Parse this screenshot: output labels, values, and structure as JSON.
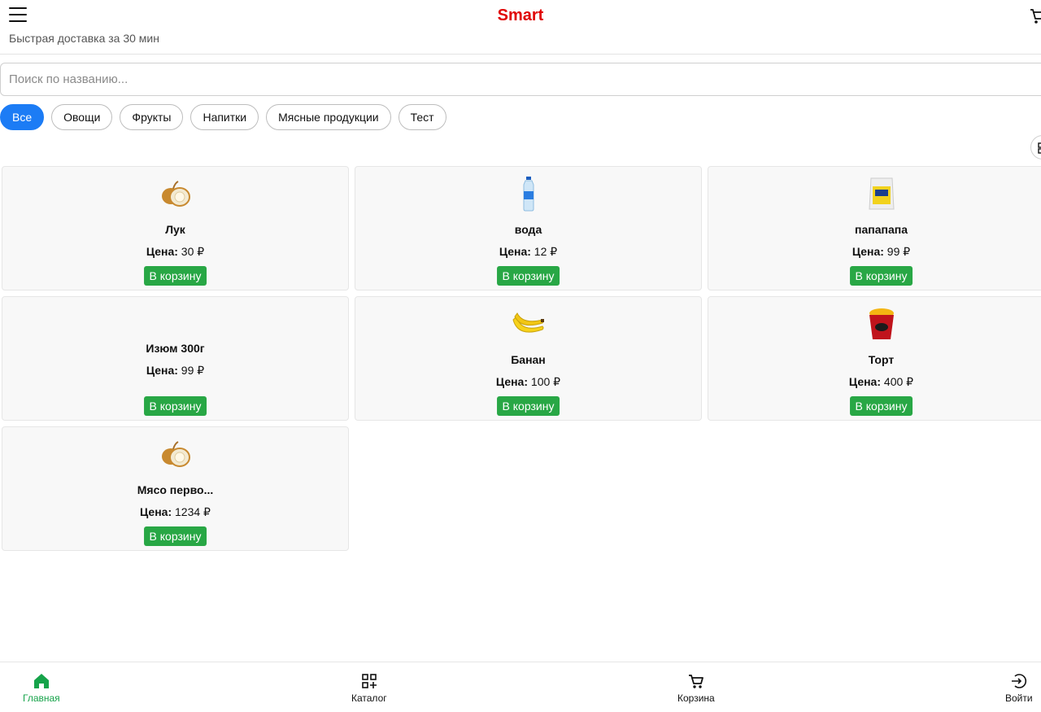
{
  "header": {
    "brand": "Smart",
    "tagline": "Быстрая доставка за 30 мин",
    "menu_icon": "hamburger-menu-icon",
    "cart_icon": "cart-icon"
  },
  "search": {
    "placeholder": "Поиск по названию..."
  },
  "categories": [
    {
      "label": "Все",
      "active": true
    },
    {
      "label": "Овощи",
      "active": false
    },
    {
      "label": "Фрукты",
      "active": false
    },
    {
      "label": "Напитки",
      "active": false
    },
    {
      "label": "Мясные продукции",
      "active": false
    },
    {
      "label": "Тест",
      "active": false
    }
  ],
  "view_toggle_icon": "grid-view-icon",
  "price_label": "Цена:",
  "currency": "₽",
  "add_to_cart_label": "В корзину",
  "products": [
    {
      "name": "Лук",
      "price": "30",
      "image": "onion-image"
    },
    {
      "name": "вода",
      "price": "12",
      "image": "water-bottle-image"
    },
    {
      "name": "папапапа",
      "price": "99",
      "image": "rice-bag-image"
    },
    {
      "name": "Изюм 300г",
      "price": "99",
      "image": ""
    },
    {
      "name": "Банан",
      "price": "100",
      "image": "banana-image"
    },
    {
      "name": "Торт",
      "price": "400",
      "image": "dessert-cup-image"
    },
    {
      "name": "Мясо перво...",
      "price": "1234",
      "image": "onion-image"
    }
  ],
  "bottom_nav": [
    {
      "label": "Главная",
      "icon": "home-icon",
      "active": true
    },
    {
      "label": "Каталог",
      "icon": "catalog-icon",
      "active": false
    },
    {
      "label": "Корзина",
      "icon": "cart-icon",
      "active": false
    },
    {
      "label": "Войти",
      "icon": "login-icon",
      "active": false
    }
  ],
  "colors": {
    "brand": "#e00000",
    "active_chip": "#1c7cf5",
    "add_button": "#28a745",
    "active_nav": "#16a34a"
  }
}
